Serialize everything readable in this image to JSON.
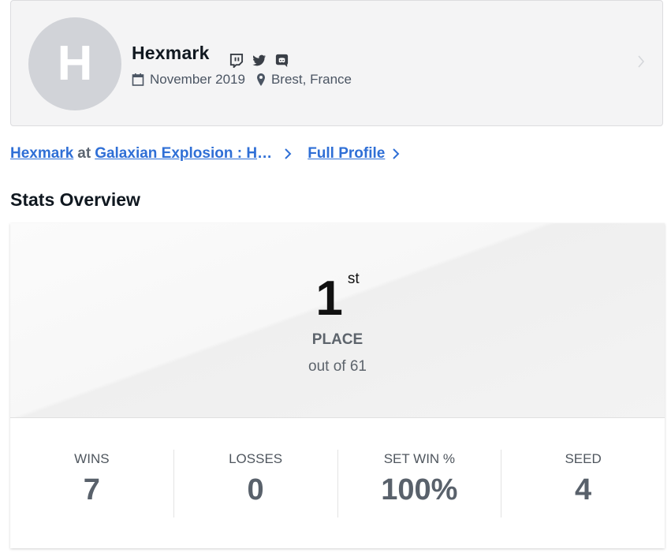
{
  "profile": {
    "avatar_letter": "H",
    "name": "Hexmark",
    "joined": "November 2019",
    "location": "Brest, France",
    "socials": [
      "twitch-icon",
      "twitter-icon",
      "discord-icon"
    ]
  },
  "links": {
    "player": "Hexmark",
    "at": "at",
    "event": "Galaxian Explosion : Heart of the Cards",
    "full_profile": "Full Profile"
  },
  "section": {
    "title": "Stats Overview"
  },
  "placing": {
    "number": "1",
    "suffix": "st",
    "label": "PLACE",
    "out_of": "out of 61"
  },
  "stats": [
    {
      "label": "WINS",
      "value": "7"
    },
    {
      "label": "LOSSES",
      "value": "0"
    },
    {
      "label": "SET WIN %",
      "value": "100%"
    },
    {
      "label": "SEED",
      "value": "4"
    }
  ],
  "colors": {
    "link": "#2f6fd6",
    "card_bg": "#f4f4f5",
    "avatar_bg": "#d1d3d8"
  }
}
